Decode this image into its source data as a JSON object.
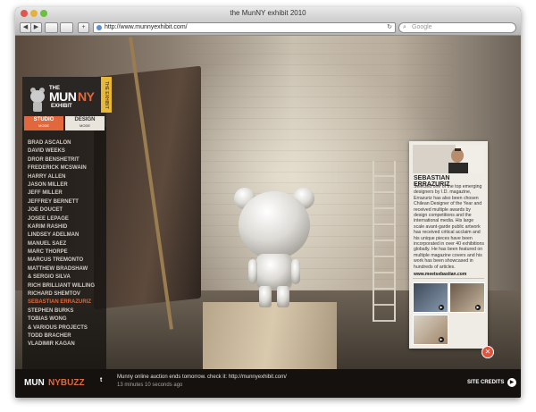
{
  "window": {
    "title": "the MunNY exhibit 2010"
  },
  "toolbar": {
    "url": "http://www.munnyexhibit.com/",
    "search_placeholder": "Google",
    "back_label": "◀",
    "forward_label": "▶",
    "reload_label": "↻",
    "add_label": "+"
  },
  "logo": {
    "the": "THE",
    "mun": "MUN",
    "ny": "NY",
    "exhibit": "EXHIBIT"
  },
  "side_tab": "THE EXHIBIT",
  "modes": [
    {
      "label": "STUDIO",
      "sub": "MODE"
    },
    {
      "label": "DESIGN",
      "sub": "MODE"
    }
  ],
  "designers": [
    "BRAD ASCALON",
    "DAVID WEEKS",
    "DROR BENSHETRIT",
    "FREDERICK MCSWAIN",
    "HARRY ALLEN",
    "JASON MILLER",
    "JEFF MILLER",
    "JEFFREY BERNETT",
    "JOE DOUCET",
    "JOSEE LEPAGE",
    "KARIM RASHID",
    "LINDSEY ADELMAN",
    "MANUEL SAEZ",
    "MARC THORPE",
    "MARCUS TREMONTO",
    "MATTHEW BRADSHAW",
    "& SERGIO SILVA",
    "RICH BRILLIANT WILLING",
    "RICHARD SHEMTOV",
    "SEBASTIAN ERRAZURIZ",
    "STEPHEN BURKS",
    "TOBIAS WONG",
    "& VARIOUS PROJECTS",
    "TODD BRACHER",
    "VLADIMIR KAGAN"
  ],
  "card": {
    "name": "SEBASTIAN ERRAZURIZ",
    "bio": "Selected one of the top emerging designers by I.D. magazine, Errazuriz has also been chosen Chilean Designer of the Year and received multiple awards by design competitions and the international media. His large scale avant-garde public artwork has received critical acclaim and his unique pieces have been incorporated in over 40 exhibitions globally. He has been featured on multiple magazine covers and his work has been showcased in hundreds of articles.",
    "link": "www.meetsebastian.com",
    "close_label": "✕"
  },
  "footer": {
    "brand_1": "MUN",
    "brand_2": "NYBUZZ",
    "twitter_icon": "t",
    "tweet": "Munny online auction ends tomorrow. check it: http://munnyexhibit.com/",
    "tweet_time": "13 minutes 10 seconds ago",
    "credits": "SITE CREDITS",
    "credits_button": "▶"
  },
  "colors": {
    "accent": "#e0683c",
    "tab_yellow": "#e8b838",
    "close_red": "#e0533c"
  }
}
